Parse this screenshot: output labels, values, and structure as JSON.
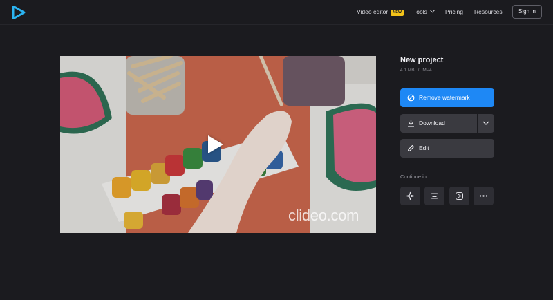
{
  "header": {
    "logo_icon": "play-logo-icon",
    "nav": {
      "video_editor": "Video editor",
      "badge": "NEW",
      "tools": "Tools",
      "pricing": "Pricing",
      "resources": "Resources"
    },
    "sign_in": "Sign In"
  },
  "player": {
    "watermark": "clideo.com",
    "play_icon": "play-icon"
  },
  "project": {
    "title": "New project",
    "size": "4.1 MB",
    "separator": "/",
    "format": "MP4"
  },
  "actions": {
    "remove_watermark": "Remove watermark",
    "download": "Download",
    "edit": "Edit"
  },
  "continue": {
    "label": "Continue in...",
    "tools": [
      "sparkle-icon",
      "subtitles-icon",
      "video-edit-icon",
      "more-icon"
    ]
  },
  "colors": {
    "background": "#1b1b1f",
    "primary": "#1e88f5",
    "badge": "#f3c319",
    "secondary_button": "#3a3a40"
  }
}
